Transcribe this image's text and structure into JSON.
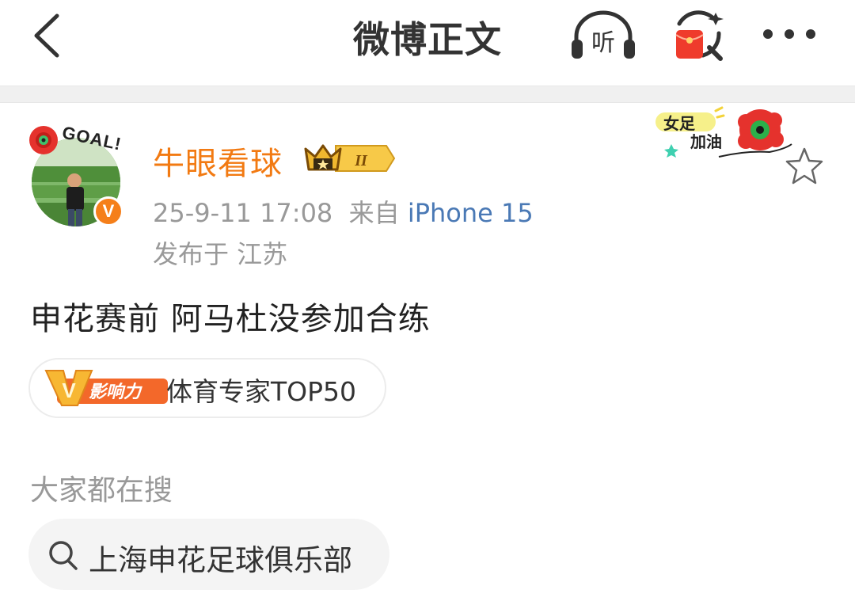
{
  "header": {
    "title": "微博正文",
    "listen_label": "听",
    "icons": [
      "back-icon",
      "listen-headphone-icon",
      "red-packet-search-icon",
      "more-icon"
    ]
  },
  "post": {
    "author": {
      "name": "牛眼看球",
      "avatar_sticker_text": "GOAL!",
      "verified_badge": "V",
      "level_badge": "II"
    },
    "time": "25-9-11 17:08",
    "source_prefix": "来自",
    "device": "iPhone 15",
    "location": "发布于 江苏",
    "decoration_text_1": "女足",
    "decoration_text_2": "加油",
    "content": "申花赛前 阿马杜没参加合练",
    "influence": {
      "badge_text": "影响力",
      "badge_letter": "V",
      "label": "体育专家TOP50"
    }
  },
  "search": {
    "section_title": "大家都在搜",
    "query": "上海申花足球俱乐部"
  },
  "colors": {
    "username": "#f27a12",
    "device": "#4a79b5",
    "meta": "#999999",
    "accent_red": "#e5322d",
    "badge_orange": "#f57f1a"
  }
}
